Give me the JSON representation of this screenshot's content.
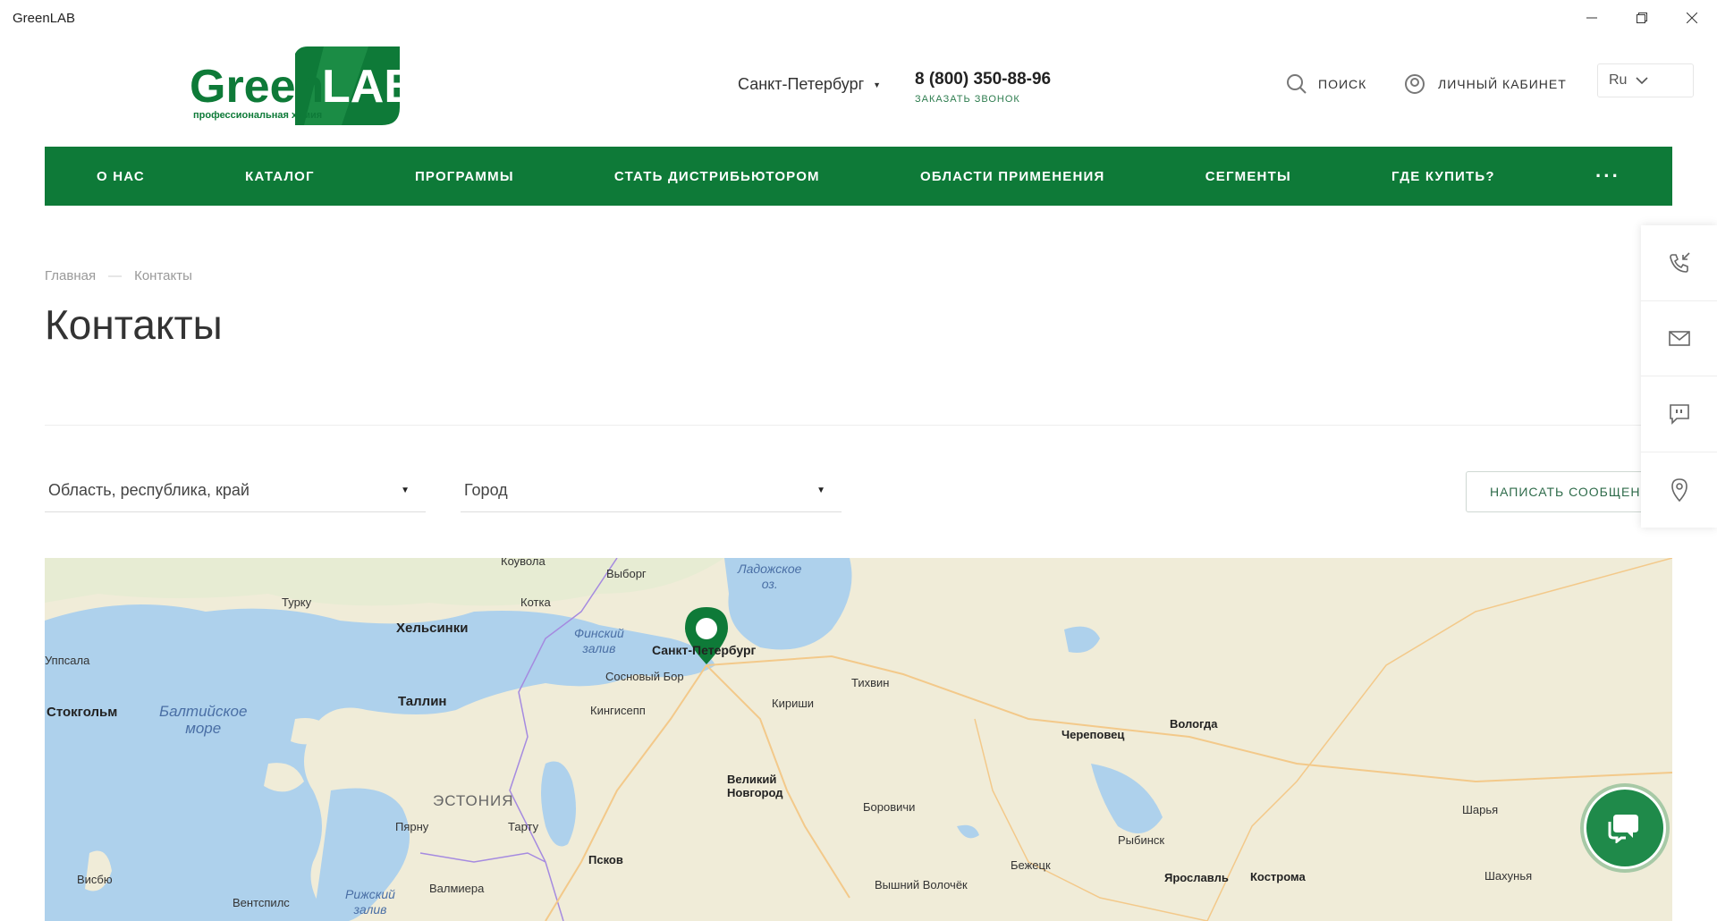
{
  "window": {
    "title": "GreenLAB"
  },
  "header": {
    "logo_main": "GreenLAB",
    "logo_tagline": "профессиональная химия",
    "city": "Санкт-Петербург",
    "phone": "8 (800) 350-88-96",
    "callback": "ЗАКАЗАТЬ ЗВОНОК",
    "search": "ПОИСК",
    "cabinet": "ЛИЧНЫЙ КАБИНЕТ",
    "lang": "Ru"
  },
  "nav": {
    "items": [
      "О НАС",
      "КАТАЛОГ",
      "ПРОГРАММЫ",
      "СТАТЬ ДИСТРИБЬЮТОРОМ",
      "ОБЛАСТИ ПРИМЕНЕНИЯ",
      "СЕГМЕНТЫ",
      "ГДЕ КУПИТЬ?"
    ],
    "more": "···"
  },
  "breadcrumb": {
    "home": "Главная",
    "sep": "—",
    "current": "Контакты"
  },
  "page": {
    "title": "Контакты"
  },
  "filters": {
    "region_placeholder": "Область, республика, край",
    "city_placeholder": "Город",
    "write_button": "НАПИСАТЬ СООБЩЕНИЕ"
  },
  "map": {
    "labels": {
      "kouvola": "Коувола",
      "vyborg": "Выборг",
      "ladoga": "Ладожское\nоз.",
      "turku": "Турку",
      "kotka": "Котка",
      "helsinki": "Хельсинки",
      "finnish_gulf": "Финский\nзалив",
      "spb": "Санкт-Петербург",
      "uppsala": "Уппсала",
      "sosnovy": "Сосновый Бор",
      "tikhvin": "Тихвин",
      "baltic": "Балтийское\nморе",
      "tallinn": "Таллин",
      "kingisepp": "Кингисепп",
      "kirishi": "Кириши",
      "stockholm": "Стокгольм",
      "cherepovets": "Череповец",
      "vologda": "Вологда",
      "novgorod": "Великий\nНовгород",
      "estonia": "ЭСТОНИЯ",
      "borovichi": "Боровичи",
      "sharya": "Шарья",
      "parnu": "Пярну",
      "tartu": "Тарту",
      "rybinsk": "Рыбинск",
      "pskov": "Псков",
      "bezhetsk": "Бежецк",
      "visby": "Висбю",
      "yaroslavl": "Ярославль",
      "kostroma": "Кострома",
      "shakhunya": "Шахунья",
      "valmiera": "Валмиера",
      "volochek": "Вышний Волочёк",
      "ventspils": "Вентспилс",
      "riga_gulf": "Рижский\nзалив"
    }
  },
  "colors": {
    "brand_green": "#0e7a38",
    "accent_green": "#1f8a4a",
    "map_water": "#aed1ec",
    "map_land": "#f0ecd8"
  }
}
